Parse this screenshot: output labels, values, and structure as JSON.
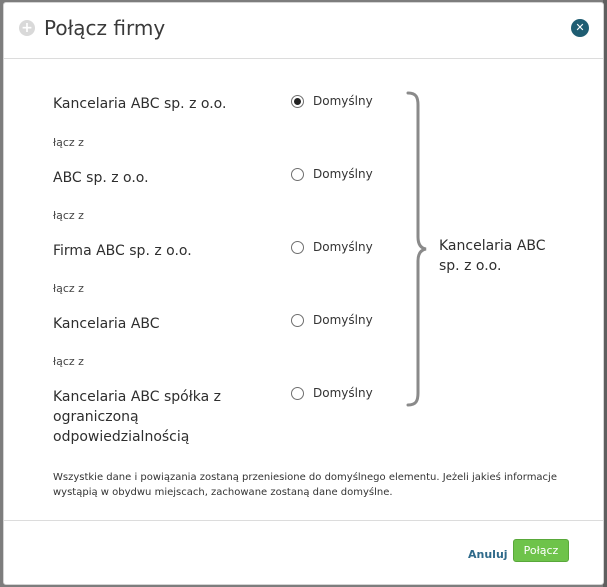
{
  "dialog": {
    "title": "Połącz firmy",
    "close_icon": "close-icon",
    "header_icon": "plus-circle-icon"
  },
  "companies": [
    {
      "name": "Kancelaria ABC sp. z o.o.",
      "selected": true
    },
    {
      "name": "ABC sp. z o.o.",
      "selected": false
    },
    {
      "name": "Firma ABC sp. z o.o.",
      "selected": false
    },
    {
      "name": "Kancelaria ABC",
      "selected": false
    },
    {
      "name": "Kancelaria ABC spółka z ograniczoną odpowiedzialnością",
      "selected": false
    }
  ],
  "connector_label": "łącz z",
  "radio_label": "Domyślny",
  "result": {
    "name": "Kancelaria ABC sp. z o.o."
  },
  "info_text": "Wszystkie dane i powiązania zostaną przeniesione do domyślnego elementu. Jeżeli jakieś informacje wystąpią w obydwu miejscach, zachowane zostaną dane domyślne.",
  "actions": {
    "cancel_label": "Anuluj",
    "confirm_label": "Połącz"
  },
  "colors": {
    "accent_green": "#6ec34a",
    "link_blue": "#2f6a8a",
    "close_bg": "#1f5d72"
  }
}
